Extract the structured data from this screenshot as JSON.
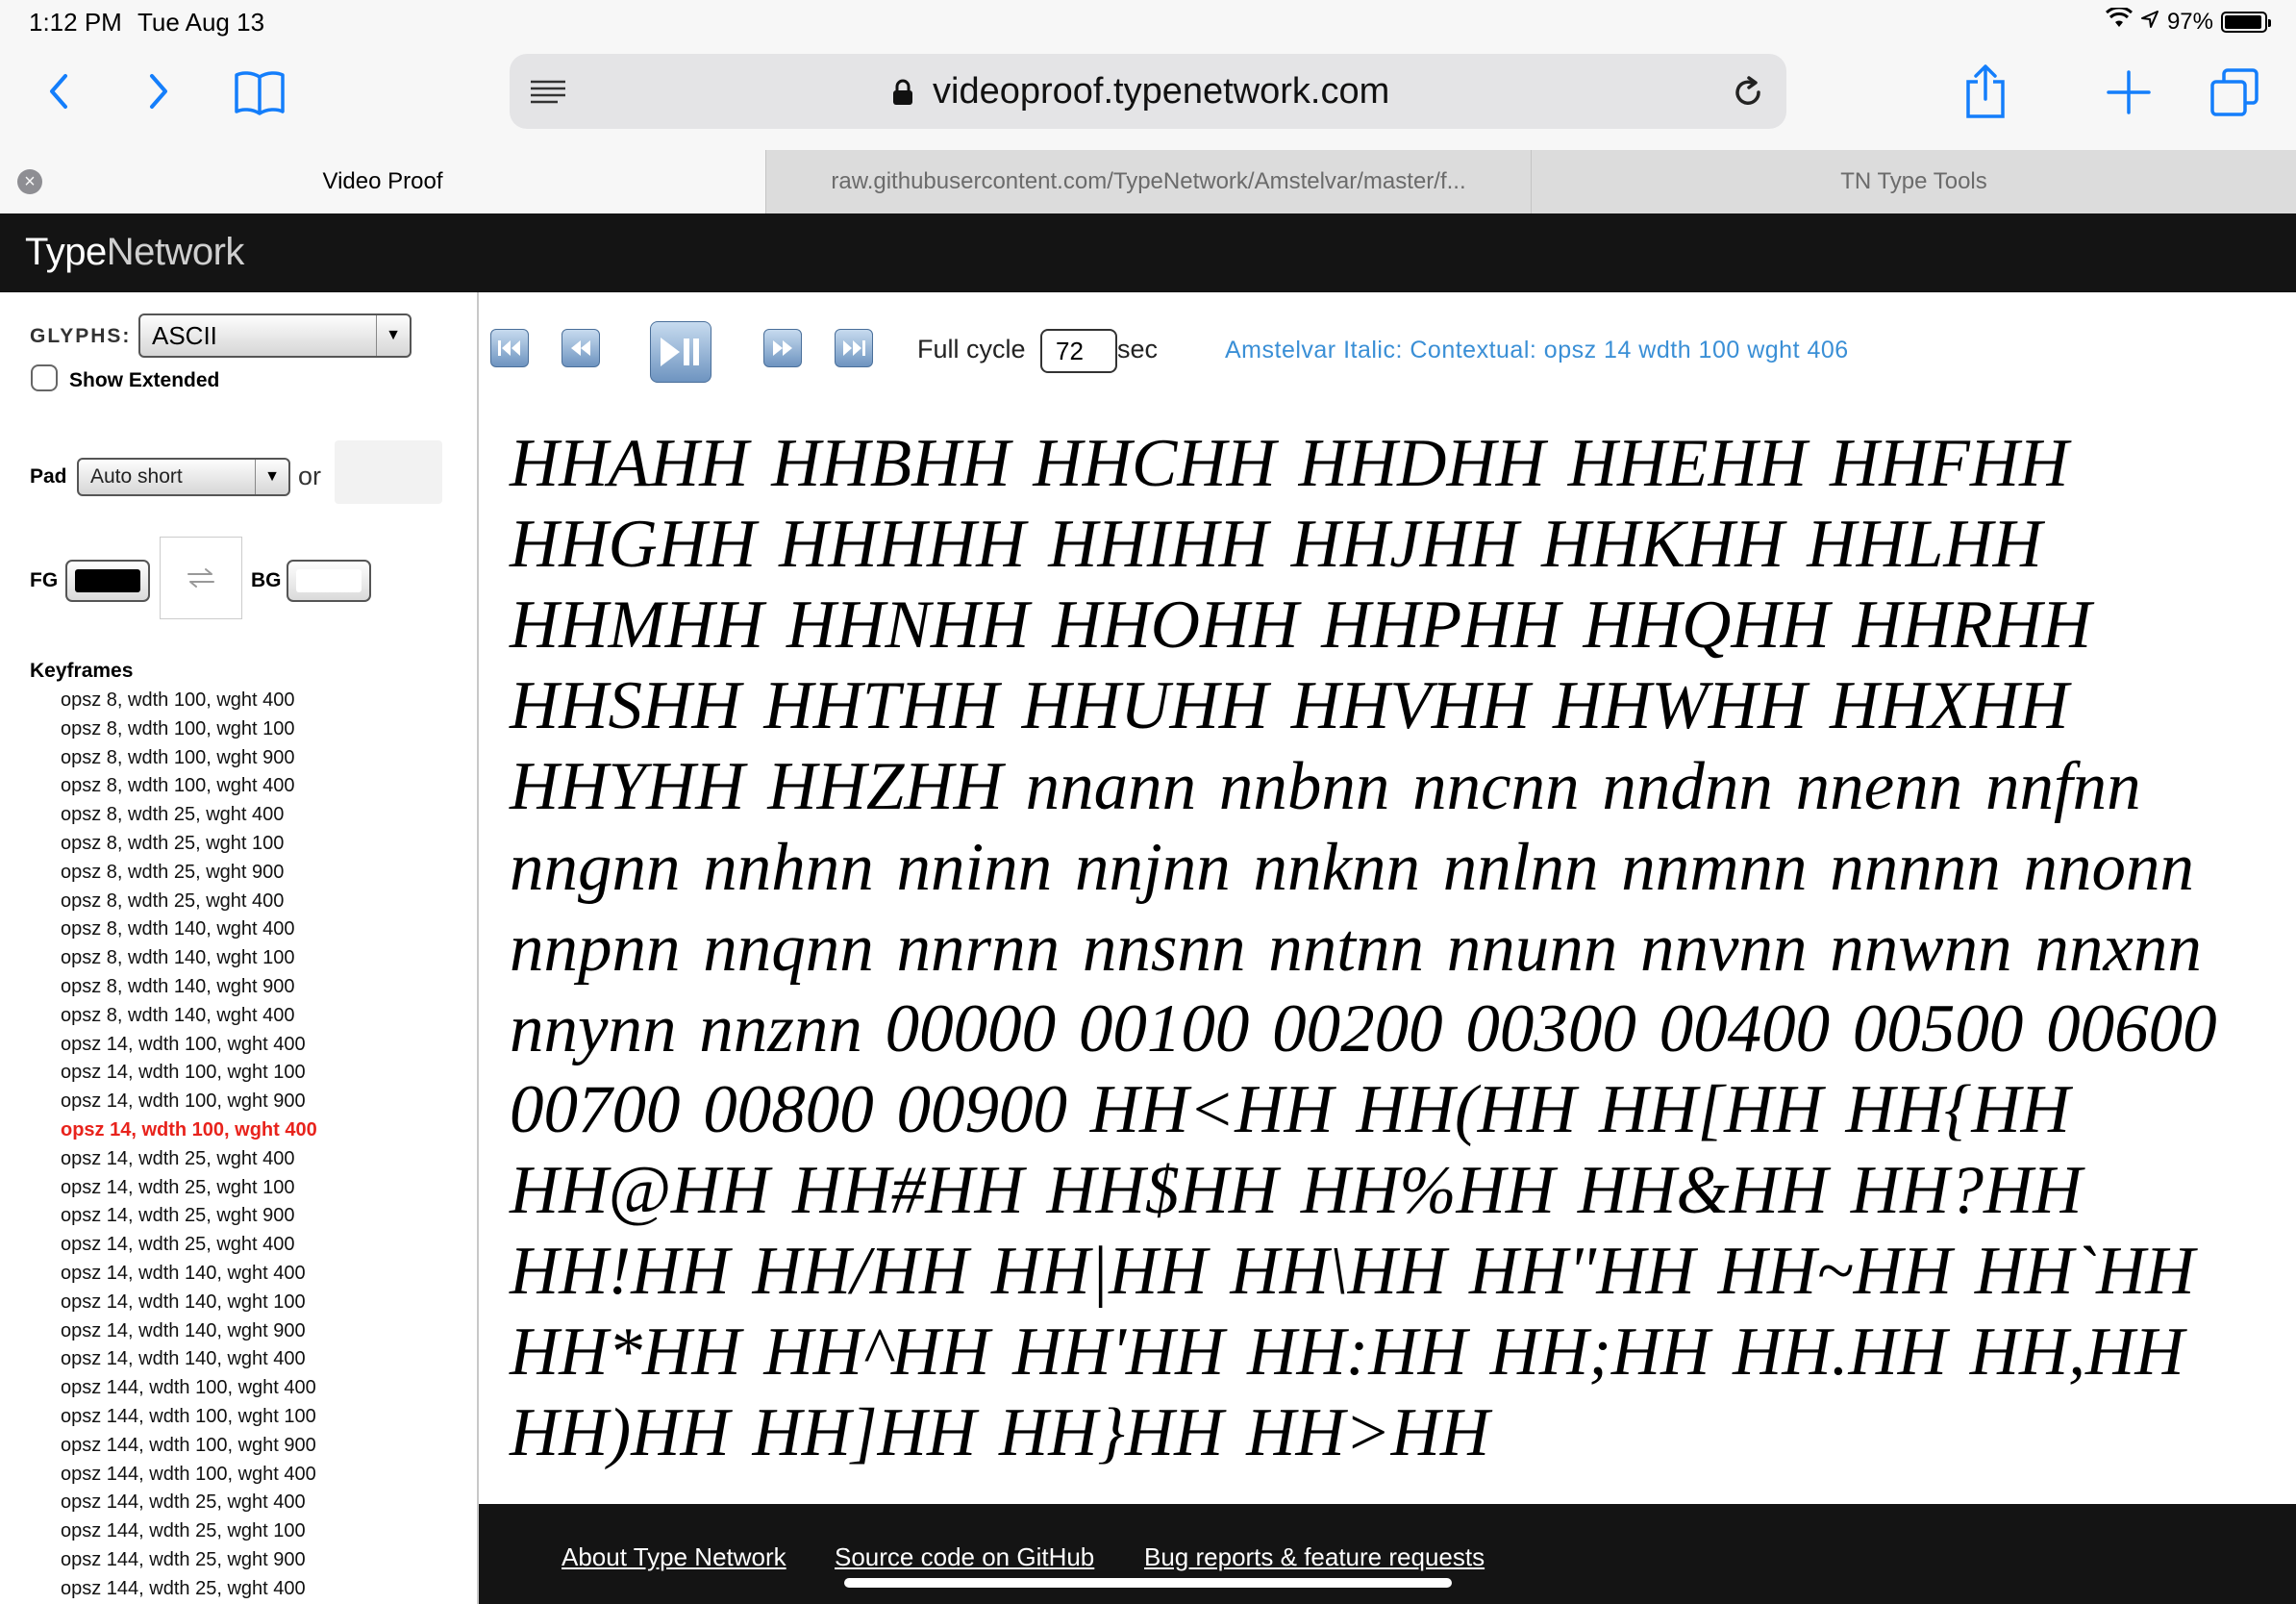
{
  "status_bar": {
    "time": "1:12 PM",
    "date": "Tue Aug 13",
    "battery": "97%",
    "icons": [
      "wifi-icon",
      "location-icon",
      "battery-icon"
    ]
  },
  "toolbar": {
    "url": "videoproof.typenetwork.com",
    "icons": [
      "back-icon",
      "forward-icon",
      "bookmarks-icon",
      "reader-icon",
      "lock-icon",
      "reload-icon",
      "share-icon",
      "new-tab-icon",
      "tabs-icon"
    ],
    "accent_color": "#147efb"
  },
  "tabs": [
    {
      "label": "Video Proof",
      "active": true
    },
    {
      "label": "raw.githubusercontent.com/TypeNetwork/Amstelvar/master/f...",
      "active": false
    },
    {
      "label": "TN Type Tools",
      "active": false
    }
  ],
  "site": {
    "logo_type": "Type",
    "logo_network": "Network"
  },
  "sidebar": {
    "glyphs_label": "GLYPHS:",
    "glyphs_value": "ASCII",
    "show_extended_label": "Show Extended",
    "show_extended_checked": false,
    "pad_label": "Pad",
    "pad_value": "Auto short",
    "or_label": "or",
    "pad_custom_value": "",
    "fg_label": "FG",
    "fg_color": "#000000",
    "bg_label": "BG",
    "bg_color": "#ffffff",
    "swap_icon": "swap-arrows-icon",
    "keyframes_title": "Keyframes",
    "keyframes": [
      "opsz 8, wdth 100, wght 400",
      "opsz 8, wdth 100, wght 100",
      "opsz 8, wdth 100, wght 900",
      "opsz 8, wdth 100, wght 400",
      "opsz 8, wdth 25, wght 400",
      "opsz 8, wdth 25, wght 100",
      "opsz 8, wdth 25, wght 900",
      "opsz 8, wdth 25, wght 400",
      "opsz 8, wdth 140, wght 400",
      "opsz 8, wdth 140, wght 100",
      "opsz 8, wdth 140, wght 900",
      "opsz 8, wdth 140, wght 400",
      "opsz 14, wdth 100, wght 400",
      "opsz 14, wdth 100, wght 100",
      "opsz 14, wdth 100, wght 900",
      "opsz 14, wdth 100, wght 400",
      "opsz 14, wdth 25, wght 400",
      "opsz 14, wdth 25, wght 100",
      "opsz 14, wdth 25, wght 900",
      "opsz 14, wdth 25, wght 400",
      "opsz 14, wdth 140, wght 400",
      "opsz 14, wdth 140, wght 100",
      "opsz 14, wdth 140, wght 900",
      "opsz 14, wdth 140, wght 400",
      "opsz 144, wdth 100, wght 400",
      "opsz 144, wdth 100, wght 100",
      "opsz 144, wdth 100, wght 900",
      "opsz 144, wdth 100, wght 400",
      "opsz 144, wdth 25, wght 400",
      "opsz 144, wdth 25, wght 100",
      "opsz 144, wdth 25, wght 900",
      "opsz 144, wdth 25, wght 400"
    ],
    "active_keyframe_index": 15,
    "active_color": "#e8231c"
  },
  "player": {
    "buttons": [
      "first-keyframe-icon",
      "prev-keyframe-icon",
      "play-pause-icon",
      "next-keyframe-icon",
      "last-keyframe-icon"
    ],
    "full_cycle_label": "Full cycle",
    "full_cycle_value": "72",
    "sec_label": "sec",
    "font_info": "Amstelvar Italic: Contextual: opsz 14 wdth 100 wght 406"
  },
  "proof_text": "HHAHH HHBHH HHCHH HHDHH HHEHH HHFHH HHGHH HHHHH HHIHH HHJHH HHKHH HHLHH HHMHH HHNHH HHOHH HHPHH HHQHH HHRHH HHSHH HHTHH HHUHH HHVHH HHWHH HHXHH HHYHH HHZHH nnann nnbnn nncnn nndnn nnenn nnfnn nngnn nnhnn nninn nnjnn nnknn nnlnn nnmnn nnnnn nnonn nnpnn nnqnn nnrnn nnsnn nntnn nnunn nnvnn nnwnn nnxnn nnynn nnznn 00000 00100 00200 00300 00400 00500 00600 00700 00800 00900 HH<HH HH(HH HH[HH HH{HH HH@HH HH#HH HH$HH HH%HH HH&HH HH?HH HH!HH HH/HH HH|HH HH\\HH HH\"HH HH~HH HH`HH HH*HH HH^HH HH'HH HH:HH HH;HH HH.HH HH,HH HH)HH HH]HH HH}HH HH>HH",
  "footer": {
    "links": [
      "About Type Network",
      "Source code on GitHub",
      "Bug reports & feature requests"
    ]
  }
}
